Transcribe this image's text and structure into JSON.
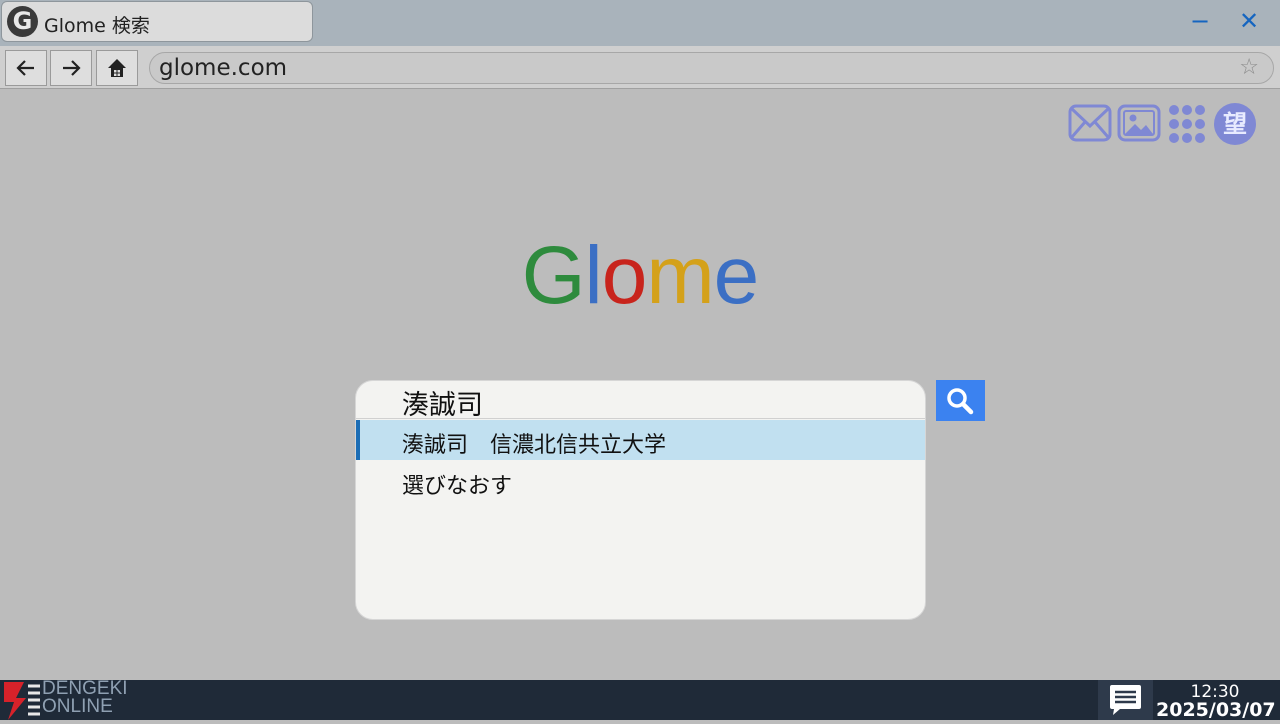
{
  "window": {
    "tab_logo_letter": "G",
    "tab_title": "Glome 検索",
    "minimize_symbol": "−",
    "close_symbol": "✕"
  },
  "toolbar": {
    "back_icon": "back-arrow-icon",
    "forward_icon": "forward-arrow-icon",
    "home_icon": "home-icon",
    "address": "glome.com",
    "bookmark_icon": "star-icon"
  },
  "header_icons": {
    "mail_icon": "mail-icon",
    "image_icon": "image-icon",
    "apps_icon": "apps-grid-icon",
    "avatar_label": "望"
  },
  "logo": {
    "letters": [
      {
        "char": "G",
        "color": "#2e8b3d"
      },
      {
        "char": "l",
        "color": "#3b6fc4"
      },
      {
        "char": "o",
        "color": "#c8241c"
      },
      {
        "char": "m",
        "color": "#d4a11a"
      },
      {
        "char": "e",
        "color": "#3b6fc4"
      }
    ]
  },
  "search": {
    "query": "湊誠司",
    "suggestions": [
      {
        "label": "湊誠司　信濃北信共立大学",
        "selected": true
      },
      {
        "label": "選びなおす",
        "selected": false
      }
    ],
    "button_icon": "search-icon"
  },
  "taskbar": {
    "watermark_line1": "DENGEKI",
    "watermark_line2": "ONLINE",
    "chat_icon": "chat-icon",
    "time": "12:30",
    "date": "2025/03/07"
  },
  "colors": {
    "accent": "#3b82f0",
    "selected_row": "#c1e0f0",
    "selected_marker": "#1b6db5",
    "taskbar": "#1f2a38"
  }
}
